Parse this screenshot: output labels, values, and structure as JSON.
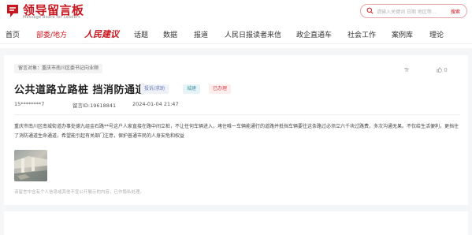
{
  "brand": {
    "title": "领导留言板",
    "subtitle": "Message Board for Leaders"
  },
  "search": {
    "placeholder": "请输入关键词 日期 地区等…",
    "button_label": "搜索"
  },
  "nav": {
    "items": [
      {
        "label": "首页"
      },
      {
        "label": "部委/地方",
        "active": true
      },
      {
        "label": "人民建议",
        "brand": true
      },
      {
        "label": "话题"
      },
      {
        "label": "数据"
      },
      {
        "label": "报道"
      },
      {
        "label": "人民日报读者来信"
      },
      {
        "label": "政企直通车"
      },
      {
        "label": "社会工作"
      },
      {
        "label": "案例库"
      },
      {
        "label": "理论"
      }
    ]
  },
  "message": {
    "target_label": "留言对象：重庆市南川区委书记向业顺",
    "font_toggle": "Tr",
    "likes": "0",
    "title": "公共道路立路桩 挡消防通道",
    "type_badge": "投诉/求助",
    "domain_badge": "城建",
    "status_badge": "已办理",
    "user": "15********7",
    "message_id": "留言ID:19618841",
    "date": "2024-01-04 21:47",
    "body": "重庆市南川区南城街道办事处德九组金石路**号这户人家直接在路中间立桩，不让任何车辆进入，堵住唯一车辆能通行的道路并抵挡车辆要往这条路过必须立六千块过路费，多次沟通无果。不仅给生活便利，更挡住了消防通道生命通道，希望能引起有关部门注意，保护普通市民的人身安危和权益",
    "image_alt": "留言附图",
    "disclaimer": "该留言中含有个人信息或其他不宜公开展示的内容，已作隐私处理。"
  },
  "colors": {
    "brand_red": "#c9151e",
    "type_badge": "#6b7fb0",
    "domain_badge": "#4a97a7",
    "status_badge": "#d9444b"
  },
  "icons": [
    "logo-mark-icon",
    "search-icon",
    "font-size-icon",
    "thumbs-up-icon"
  ]
}
